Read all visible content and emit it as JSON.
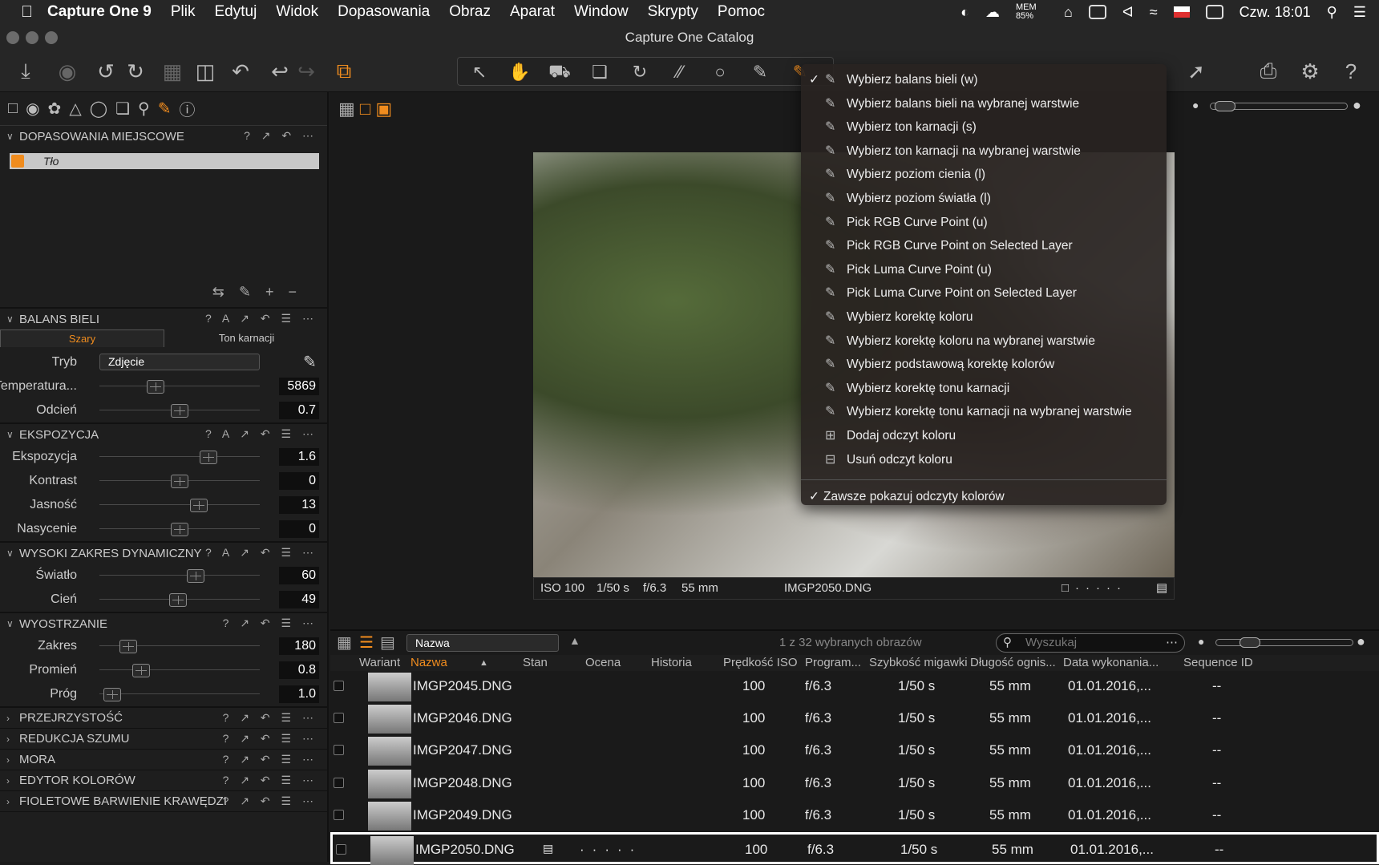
{
  "menubar": {
    "app": "Capture One 9",
    "items": [
      "Plik",
      "Edytuj",
      "Widok",
      "Dopasowania",
      "Obraz",
      "Aparat",
      "Window",
      "Skrypty",
      "Pomoc"
    ],
    "mem": "MEM 85%",
    "clock": "Czw. 18:01"
  },
  "window": {
    "title": "Capture One Catalog"
  },
  "left": {
    "local": {
      "title": "DOPASOWANIA MIEJSCOWE",
      "layer": "Tło"
    },
    "wb": {
      "title": "BALANS BIELI",
      "tab1": "Szary",
      "tab2": "Ton karnacji",
      "mode_label": "Tryb",
      "mode_value": "Zdjęcie",
      "rows": [
        {
          "label": "Temperatura...",
          "value": "5869",
          "level": 0.35
        },
        {
          "label": "Odcień",
          "value": "0.7",
          "level": 0.5
        }
      ]
    },
    "exposure": {
      "title": "EKSPOZYCJA",
      "rows": [
        {
          "label": "Ekspozycja",
          "value": "1.6",
          "level": 0.68
        },
        {
          "label": "Kontrast",
          "value": "0",
          "level": 0.5
        },
        {
          "label": "Jasność",
          "value": "13",
          "level": 0.62
        },
        {
          "label": "Nasycenie",
          "value": "0",
          "level": 0.5
        }
      ]
    },
    "hdr": {
      "title": "WYSOKI ZAKRES DYNAMICZNY",
      "rows": [
        {
          "label": "Światło",
          "value": "60",
          "level": 0.6
        },
        {
          "label": "Cień",
          "value": "49",
          "level": 0.49
        }
      ]
    },
    "sharp": {
      "title": "WYOSTRZANIE",
      "rows": [
        {
          "label": "Zakres",
          "value": "180",
          "level": 0.18
        },
        {
          "label": "Promień",
          "value": "0.8",
          "level": 0.26
        },
        {
          "label": "Próg",
          "value": "1.0",
          "level": 0.08
        }
      ]
    },
    "collapsed": [
      "PRZEJRZYSTOŚĆ",
      "REDUKCJA SZUMU",
      "MORA",
      "EDYTOR KOLORÓW",
      "FIOLETOWE BARWIENIE KRAWĘDZI"
    ]
  },
  "viewer": {
    "iso": "ISO 100",
    "shutter": "1/50 s",
    "aperture": "f/6.3",
    "focal": "55 mm",
    "filename": "IMGP2050.DNG"
  },
  "menu": {
    "items": [
      {
        "label": "Wybierz balans bieli (w)",
        "checked": true
      },
      {
        "label": "Wybierz balans bieli na wybranej warstwie"
      },
      {
        "label": "Wybierz ton karnacji (s)"
      },
      {
        "label": "Wybierz ton karnacji na wybranej warstwie"
      },
      {
        "label": "Wybierz poziom cienia (l)"
      },
      {
        "label": "Wybierz poziom światła (l)"
      },
      {
        "label": "Pick RGB Curve Point (u)"
      },
      {
        "label": "Pick RGB Curve Point on Selected Layer"
      },
      {
        "label": "Pick Luma Curve Point (u)"
      },
      {
        "label": "Pick Luma Curve Point on Selected Layer"
      },
      {
        "label": "Wybierz korektę koloru"
      },
      {
        "label": "Wybierz korektę koloru na wybranej warstwie"
      },
      {
        "label": "Wybierz podstawową korektę kolorów"
      },
      {
        "label": "Wybierz korektę tonu karnacji"
      },
      {
        "label": "Wybierz korektę tonu karnacji na wybranej warstwie"
      },
      {
        "label": "Dodaj odczyt koloru"
      },
      {
        "label": "Usuń odczyt koloru"
      }
    ],
    "always": "Zawsze pokazuj odczyty kolorów"
  },
  "browser": {
    "sort": "Nazwa",
    "count": "1 z 32 wybranych obrazów",
    "search_placeholder": "Wyszukaj",
    "columns": [
      "Wariant",
      "Nazwa",
      "Stan",
      "Ocena",
      "Historia",
      "Prędkość ISO",
      "Program...",
      "Szybkość migawki",
      "Długość ognis...",
      "Data wykonania...",
      "Sequence ID"
    ],
    "rows": [
      {
        "name": "IMGP2045.DNG",
        "iso": "100",
        "prog": "f/6.3",
        "shutter": "1/50 s",
        "focal": "55 mm",
        "date": "01.01.2016,...",
        "seq": "--"
      },
      {
        "name": "IMGP2046.DNG",
        "iso": "100",
        "prog": "f/6.3",
        "shutter": "1/50 s",
        "focal": "55 mm",
        "date": "01.01.2016,...",
        "seq": "--"
      },
      {
        "name": "IMGP2047.DNG",
        "iso": "100",
        "prog": "f/6.3",
        "shutter": "1/50 s",
        "focal": "55 mm",
        "date": "01.01.2016,...",
        "seq": "--"
      },
      {
        "name": "IMGP2048.DNG",
        "iso": "100",
        "prog": "f/6.3",
        "shutter": "1/50 s",
        "focal": "55 mm",
        "date": "01.01.2016,...",
        "seq": "--"
      },
      {
        "name": "IMGP2049.DNG",
        "iso": "100",
        "prog": "f/6.3",
        "shutter": "1/50 s",
        "focal": "55 mm",
        "date": "01.01.2016,...",
        "seq": "--"
      },
      {
        "name": "IMGP2050.DNG",
        "iso": "100",
        "prog": "f/6.3",
        "shutter": "1/50 s",
        "focal": "55 mm",
        "date": "01.01.2016,...",
        "seq": "--",
        "selected": true
      }
    ]
  }
}
